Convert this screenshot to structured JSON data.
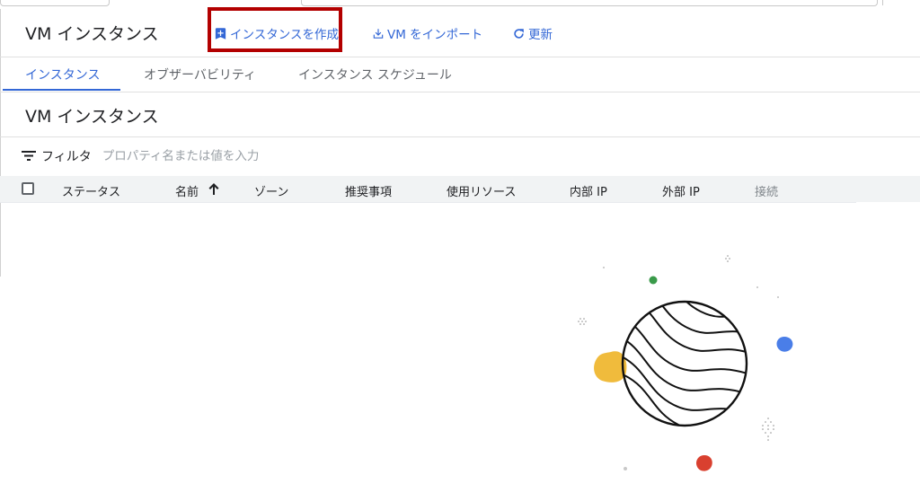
{
  "header": {
    "title": "VM インスタンス",
    "create_label": "インスタンスを作成",
    "import_label": "VM をインポート",
    "refresh_label": "更新"
  },
  "tabs": [
    {
      "label": "インスタンス",
      "active": true
    },
    {
      "label": "オブザーバビリティ",
      "active": false
    },
    {
      "label": "インスタンス スケジュール",
      "active": false
    }
  ],
  "section": {
    "title": "VM インスタンス"
  },
  "filter": {
    "label": "フィルタ",
    "placeholder": "プロパティ名または値を入力",
    "value": ""
  },
  "table": {
    "columns": [
      "ステータス",
      "名前",
      "ゾーン",
      "推奨事項",
      "使用リソース",
      "内部 IP",
      "外部 IP",
      "接続"
    ],
    "sort_column": "名前",
    "sort_direction": "ascending",
    "rows": []
  },
  "colors": {
    "accent": "#3367d6",
    "highlight_box": "#b30000",
    "header_bg": "#f1f3f4",
    "blob_yellow": "#f0bb3c",
    "blob_blue": "#4a7ee8",
    "blob_red": "#d9402f",
    "blob_green": "#3a9a4a"
  },
  "icons": [
    "add-box-icon",
    "download-icon",
    "refresh-icon",
    "filter-icon",
    "sort-arrow-up-icon",
    "empty-state-globe-illustration"
  ]
}
